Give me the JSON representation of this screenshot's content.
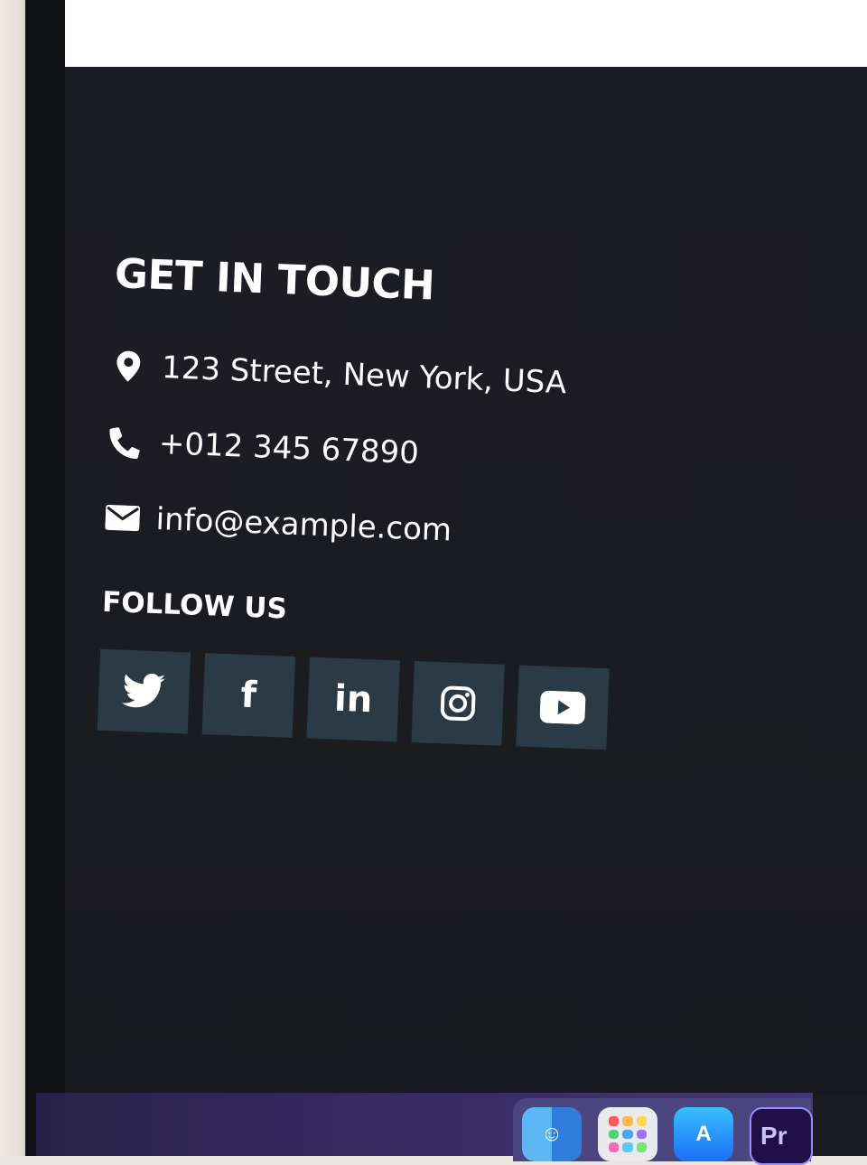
{
  "footer": {
    "title": "GET IN TOUCH",
    "contacts": [
      {
        "icon": "location-pin-icon",
        "text": "123 Street, New York, USA"
      },
      {
        "icon": "phone-icon",
        "text": "+012 345 67890"
      },
      {
        "icon": "envelope-icon",
        "text": "info@example.com"
      }
    ],
    "follow_title": "FOLLOW US",
    "social": [
      {
        "icon": "twitter-icon",
        "label": ""
      },
      {
        "icon": "facebook-icon",
        "label": "f"
      },
      {
        "icon": "linkedin-icon",
        "label": "in"
      },
      {
        "icon": "instagram-icon",
        "label": ""
      },
      {
        "icon": "youtube-icon",
        "label": ""
      }
    ]
  },
  "dock": {
    "items": [
      {
        "icon": "finder-icon"
      },
      {
        "icon": "launchpad-icon"
      },
      {
        "icon": "app-store-icon"
      },
      {
        "icon": "premiere-pro-icon",
        "label": "Pr"
      }
    ]
  },
  "colors": {
    "footer_bg": "#1b1c21",
    "social_bg": "#2c3a45",
    "text": "#ffffff"
  }
}
